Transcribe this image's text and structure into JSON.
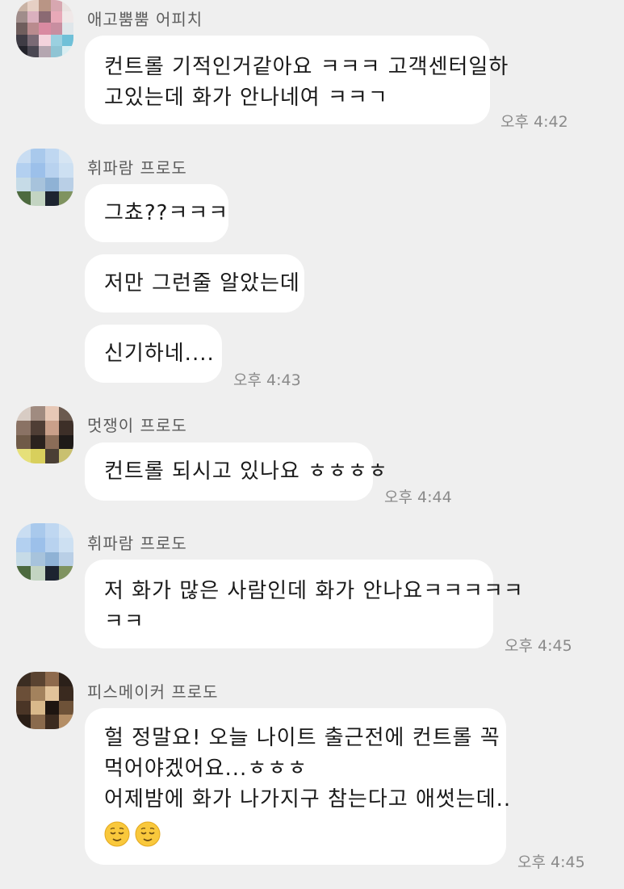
{
  "messages": [
    {
      "sender": "애고뿜뿜 어피치",
      "bubbles": [
        {
          "lines": [
            "컨트롤 기적인거같아요 ㅋㅋㅋ 고객센터일하",
            "고있는데 화가 안나네여 ㅋㅋㄱ"
          ]
        }
      ],
      "time": "오후 4:42"
    },
    {
      "sender": "휘파람 프로도",
      "bubbles": [
        {
          "lines": [
            "그쵸??ㅋㅋㅋ"
          ]
        },
        {
          "lines": [
            "저만 그런줄 알았는데"
          ]
        },
        {
          "lines": [
            "신기하네...."
          ]
        }
      ],
      "time": "오후 4:43"
    },
    {
      "sender": "멋쟁이 프로도",
      "bubbles": [
        {
          "lines": [
            "컨트롤 되시고 있나요 ㅎㅎㅎㅎ"
          ]
        }
      ],
      "time": "오후 4:44"
    },
    {
      "sender": "휘파람 프로도",
      "bubbles": [
        {
          "lines": [
            "저 화가 많은 사람인데 화가 안나요ㅋㅋㅋㅋㅋ",
            "ㅋㅋ"
          ]
        }
      ],
      "time": "오후 4:45"
    },
    {
      "sender": "피스메이커 프로도",
      "bubbles": [
        {
          "lines": [
            "헐 정말요! 오늘 나이트 출근전에 컨트롤 꼭",
            "먹어야겠어요...ㅎㅎㅎ",
            "어제밤에 화가 나가지구 참는다고 애썻는데.."
          ],
          "emoji": [
            "relieved-face-emoji",
            "relieved-face-emoji"
          ]
        }
      ],
      "time": "오후 4:45"
    }
  ],
  "colors": {
    "background": "#efefef",
    "bubble": "#ffffff",
    "text": "#1a1a1a",
    "sender": "#5c5c5c",
    "time": "#8a8a8a"
  }
}
